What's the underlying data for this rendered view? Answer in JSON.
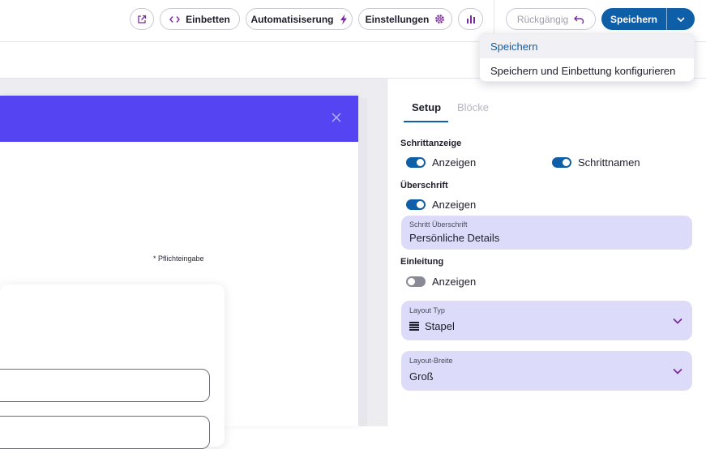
{
  "toolbar": {
    "embed_label": "Einbetten",
    "automation_label": "Automatisiserung",
    "settings_label": "Einstellungen",
    "undo_label": "Rückgängig",
    "save_label": "Speichern"
  },
  "save_menu": {
    "items": [
      {
        "label": "Speichern"
      },
      {
        "label": "Speichern und Einbettung konfigurieren"
      }
    ]
  },
  "form_preview": {
    "required_note": "* Pflichteingabe"
  },
  "panel": {
    "tabs": [
      {
        "label": "Setup"
      },
      {
        "label": "Blöcke"
      }
    ],
    "step_display": {
      "title": "Schrittanzeige",
      "show_label": "Anzeigen",
      "names_label": "Schrittnamen"
    },
    "heading": {
      "title": "Überschrift",
      "show_label": "Anzeigen",
      "field_label": "Schritt Überschrift",
      "field_value": "Persönliche Details"
    },
    "intro": {
      "title": "Einleitung",
      "show_label": "Anzeigen"
    },
    "layout_type": {
      "label": "Layout Typ",
      "value": "Stapel"
    },
    "layout_width": {
      "label": "Layout-Breite",
      "value": "Groß"
    }
  },
  "colors": {
    "primary": "#0f5fa8",
    "form_header": "#5444f2",
    "field_bg": "#dcdcfa",
    "accent_icon": "#7b2a9e"
  }
}
